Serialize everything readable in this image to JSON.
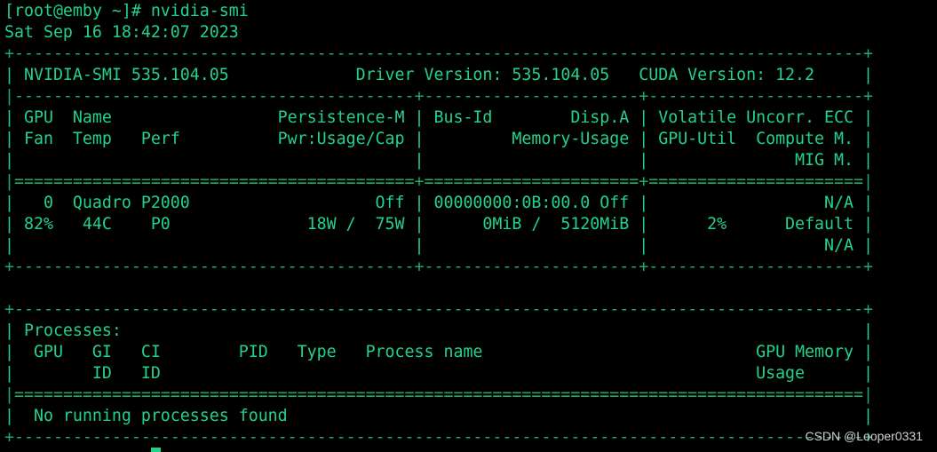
{
  "terminal": {
    "lines": [
      "[root@emby ~]# nvidia-smi",
      "Sat Sep 16 18:42:07 2023",
      "+---------------------------------------------------------------------------------------+",
      "| NVIDIA-SMI 535.104.05             Driver Version: 535.104.05   CUDA Version: 12.2     |",
      "|-----------------------------------------+----------------------+----------------------+",
      "| GPU  Name                 Persistence-M | Bus-Id        Disp.A | Volatile Uncorr. ECC |",
      "| Fan  Temp   Perf          Pwr:Usage/Cap |         Memory-Usage | GPU-Util  Compute M. |",
      "|                                         |                      |               MIG M. |",
      "|=========================================+======================+======================|",
      "|   0  Quadro P2000                   Off | 00000000:0B:00.0 Off |                  N/A |",
      "| 82%   44C    P0              18W /  75W |      0MiB /  5120MiB |      2%      Default |",
      "|                                         |                      |                  N/A |",
      "+-----------------------------------------+----------------------+----------------------+",
      "",
      "+---------------------------------------------------------------------------------------+",
      "| Processes:                                                                            |",
      "|  GPU   GI   CI        PID   Type   Process name                            GPU Memory |",
      "|        ID   ID                                                             Usage      |",
      "|=======================================================================================|",
      "|  No running processes found                                                           |",
      "+---------------------------------------------------------------------------------------+"
    ]
  },
  "watermark": "CSDN @Looper0331",
  "colors": {
    "background": "#000000",
    "text": "#23d18b",
    "watermark": "#d0d0d0"
  }
}
